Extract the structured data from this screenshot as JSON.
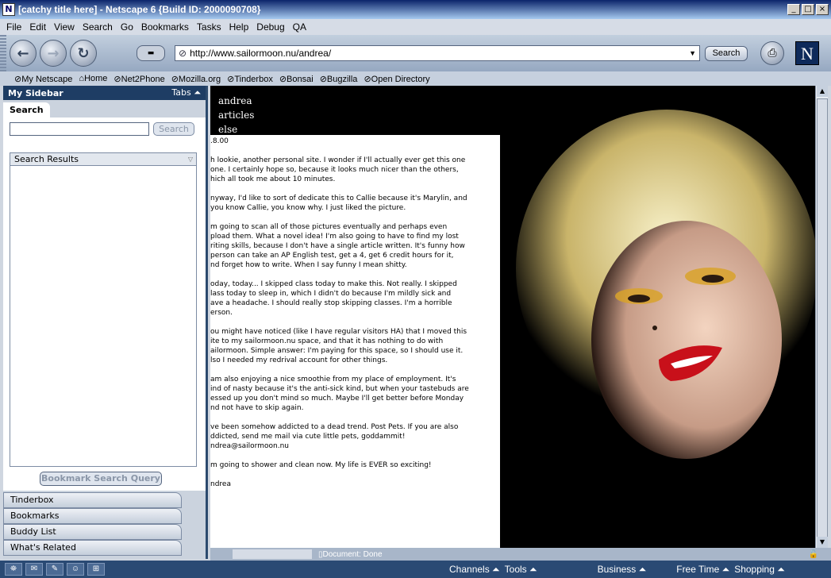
{
  "window": {
    "title": "[catchy title here] - Netscape 6 {Build ID: 2000090708}",
    "app_icon": "N",
    "buttons": [
      "_",
      "□",
      "×"
    ]
  },
  "menu": [
    "File",
    "Edit",
    "View",
    "Search",
    "Go",
    "Bookmarks",
    "Tasks",
    "Help",
    "Debug",
    "QA"
  ],
  "nav": {
    "back_icon": "back-arrow-icon",
    "forward_icon": "forward-arrow-icon",
    "reload_icon": "reload-icon",
    "url": "http://www.sailormoon.nu/andrea/",
    "search_label": "Search",
    "logo": "N"
  },
  "personal_toolbar": [
    "My Netscape",
    "Home",
    "Net2Phone",
    "Mozilla.org",
    "Tinderbox",
    "Bonsai",
    "Bugzilla",
    "Open Directory"
  ],
  "sidebar": {
    "title": "My Sidebar",
    "tabs_label": "Tabs ⏶",
    "active_tab": "Search",
    "search_button": "Search",
    "results_header": "Search Results",
    "bookmark_query_button": "Bookmark Search Query",
    "panels": [
      "Tinderbox",
      "Bookmarks",
      "Buddy List",
      "What's Related"
    ]
  },
  "page": {
    "nav_links": [
      "andrea",
      "articles",
      "else"
    ],
    "date": ".8.00",
    "paragraphs": [
      "h lookie, another personal site. I wonder if I'll actually ever get this one\none. I certainly hope so, because it looks much nicer than the others,\nhich all took me about 10 minutes.",
      "nyway, I'd like to sort of dedicate this to Callie because it's Marylin, and\n you know Callie, you know why. I just liked the picture.",
      "m going to scan all of those pictures eventually and perhaps even\npload them. What a novel idea! I'm also going to have to find my lost\nriting skills, because I don't have a single article written. It's funny how\n person can take an AP English test, get a 4, get 6 credit hours for it,\nnd forget how to write. When I say funny I mean shitty.",
      "oday, today... I skipped class today to make this. Not really. I skipped\nlass today to sleep in, which I didn't do because I'm mildly sick and\nave a headache. I should really stop skipping classes. I'm a horrible\nerson.",
      "ou might have noticed (like I have regular visitors HA) that I moved this\nite to my sailormoon.nu space, and that it has nothing to do with\nailormoon. Simple answer: I'm paying for this space, so I should use it.\nlso I needed my redrival account for other things.",
      " am also enjoying a nice smoothie from my place of employment. It's\nind of nasty because it's the anti-sick kind, but when your tastebuds are\nessed up you don't mind so much. Maybe I'll get better before Monday\nnd not have to skip again.",
      "ve been somehow addicted to a dead trend. Post Pets. If you are also\nddicted, send me mail via cute little pets, goddammit!\nndrea@sailormoon.nu",
      "m going to shower and clean now. My life is EVER so exciting!",
      "ndrea"
    ]
  },
  "status": {
    "text": "Document: Done"
  },
  "taskbar": {
    "links": [
      "Channels ⏶",
      "Tools ⏶",
      "Business ⏶",
      "Free Time ⏶",
      "Shopping ⏶"
    ]
  }
}
